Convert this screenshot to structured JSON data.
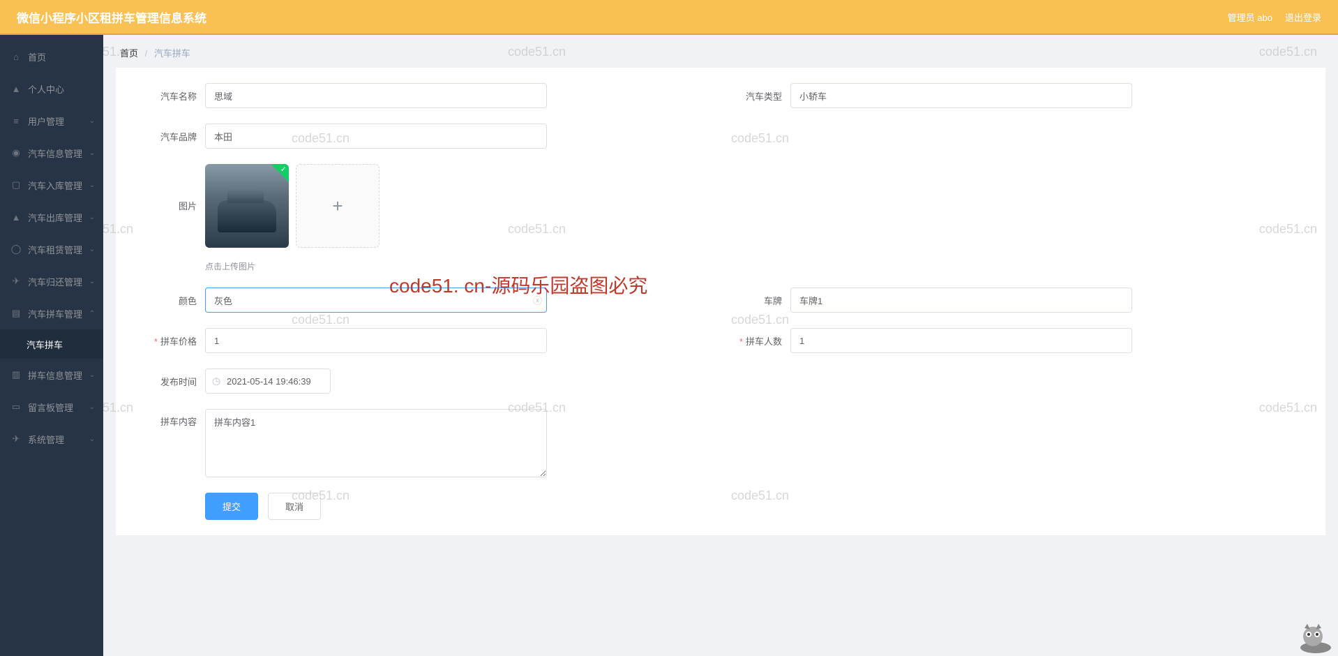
{
  "header": {
    "title": "微信小程序小区租拼车管理信息系统",
    "admin": "管理员 abo",
    "logout": "退出登录"
  },
  "sidebar": {
    "items": [
      {
        "label": "首页",
        "icon": "home-icon"
      },
      {
        "label": "个人中心",
        "icon": "user-icon"
      },
      {
        "label": "用户管理",
        "icon": "list-icon",
        "expand": true
      },
      {
        "label": "汽车信息管理",
        "icon": "dash-icon",
        "expand": true
      },
      {
        "label": "汽车入库管理",
        "icon": "doc-icon",
        "expand": true
      },
      {
        "label": "汽车出库管理",
        "icon": "people-icon",
        "expand": true
      },
      {
        "label": "汽车租赁管理",
        "icon": "globe-icon",
        "expand": true
      },
      {
        "label": "汽车归还管理",
        "icon": "plane-icon",
        "expand": true
      },
      {
        "label": "汽车拼车管理",
        "icon": "news-icon",
        "expand": true,
        "sub": [
          {
            "label": "汽车拼车"
          }
        ]
      },
      {
        "label": "拼车信息管理",
        "icon": "chart-icon",
        "expand": true
      },
      {
        "label": "留言板管理",
        "icon": "monitor-icon",
        "expand": true
      },
      {
        "label": "系统管理",
        "icon": "send-icon",
        "expand": true
      }
    ]
  },
  "breadcrumb": {
    "home": "首页",
    "current": "汽车拼车"
  },
  "form": {
    "car_name": {
      "label": "汽车名称",
      "value": "思域"
    },
    "car_type": {
      "label": "汽车类型",
      "value": "小轿车"
    },
    "car_brand": {
      "label": "汽车品牌",
      "value": "本田"
    },
    "picture": {
      "label": "图片",
      "tip": "点击上传图片"
    },
    "color": {
      "label": "颜色",
      "value": "灰色"
    },
    "plate": {
      "label": "车牌",
      "value": "车牌1"
    },
    "price": {
      "label": "拼车价格",
      "value": "1"
    },
    "people": {
      "label": "拼车人数",
      "value": "1"
    },
    "pub_time": {
      "label": "发布时间",
      "value": "2021-05-14 19:46:39"
    },
    "content": {
      "label": "拼车内容",
      "value": "拼车内容1"
    }
  },
  "buttons": {
    "submit": "提交",
    "cancel": "取消"
  },
  "watermarks": {
    "small": "code51.cn",
    "big": "code51. cn-源码乐园盗图必究"
  }
}
